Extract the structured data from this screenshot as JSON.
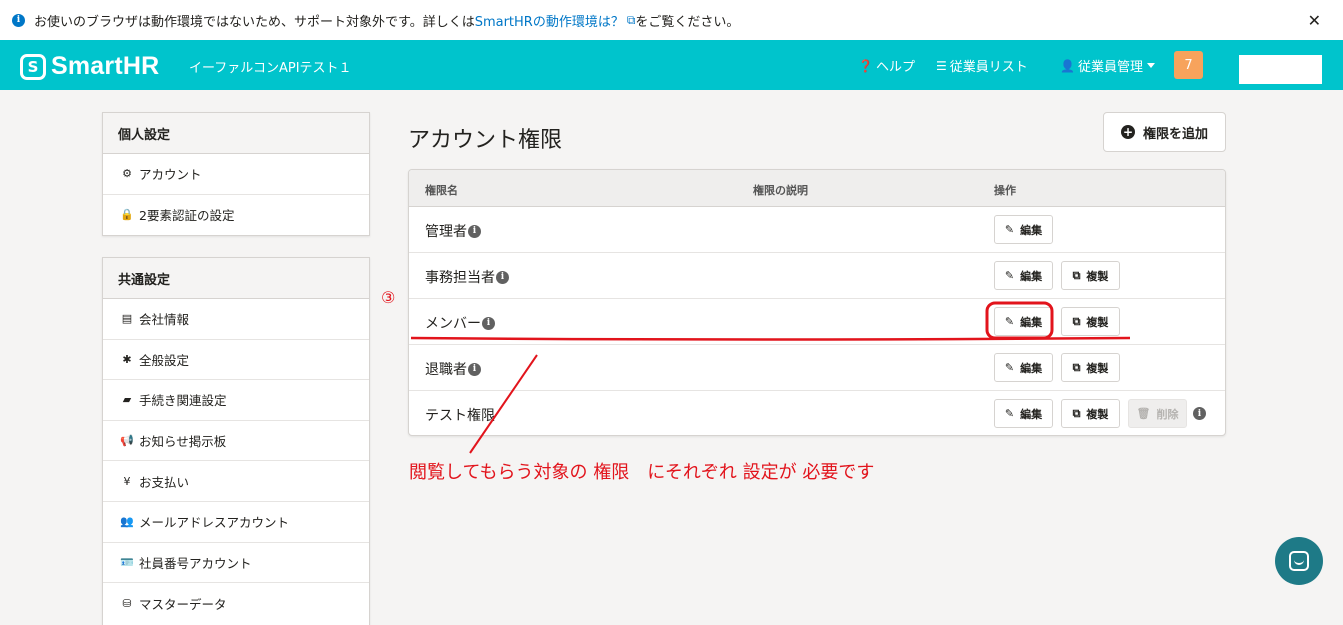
{
  "notice": {
    "text": "お使いのブラウザは動作環境ではないため、サポート対象外です。詳しくは",
    "link": "SmartHRの動作環境は？",
    "suffix": "をご覧ください。"
  },
  "header": {
    "logo_mark": "S",
    "logo": "SmartHR",
    "tenant": "イーファルコンAPIテスト１",
    "help": "ヘルプ",
    "employee_list": "従業員リスト",
    "employee_mgmt": "従業員管理",
    "badge": "7"
  },
  "sidebar": {
    "personal": {
      "title": "個人設定",
      "items": [
        {
          "icon": "gear-icon",
          "label": "アカウント"
        },
        {
          "icon": "lock-icon",
          "label": "2要素認証の設定"
        }
      ]
    },
    "common": {
      "title": "共通設定",
      "items": [
        {
          "icon": "building-icon",
          "label": "会社情報"
        },
        {
          "icon": "asterisk-icon",
          "label": "全般設定"
        },
        {
          "icon": "book-icon",
          "label": "手続き関連設定"
        },
        {
          "icon": "bullhorn-icon",
          "label": "お知らせ掲示板"
        },
        {
          "icon": "yen-icon",
          "label": "お支払い"
        },
        {
          "icon": "users-icon",
          "label": "メールアドレスアカウント"
        },
        {
          "icon": "id-card-icon",
          "label": "社員番号アカウント"
        },
        {
          "icon": "database-icon",
          "label": "マスターデータ"
        }
      ]
    }
  },
  "main": {
    "title": "アカウント権限",
    "add_button": "権限を追加",
    "table": {
      "headers": [
        "権限名",
        "権限の説明",
        "操作"
      ],
      "rows": [
        {
          "name": "管理者",
          "info": true,
          "actions": [
            "edit"
          ]
        },
        {
          "name": "事務担当者",
          "info": true,
          "actions": [
            "edit",
            "copy"
          ]
        },
        {
          "name": "メンバー",
          "info": true,
          "actions": [
            "edit",
            "copy"
          ]
        },
        {
          "name": "退職者",
          "info": true,
          "actions": [
            "edit",
            "copy"
          ]
        },
        {
          "name": "テスト権限",
          "info": false,
          "actions": [
            "edit",
            "copy",
            "delete"
          ]
        }
      ],
      "edit_label": "編集",
      "copy_label": "複製",
      "delete_label": "削除"
    }
  },
  "annotations": {
    "step": "③",
    "caption": "閲覧してもらう対象の 権限　にそれぞれ 設定が 必要です",
    "color": "#e2141c"
  }
}
